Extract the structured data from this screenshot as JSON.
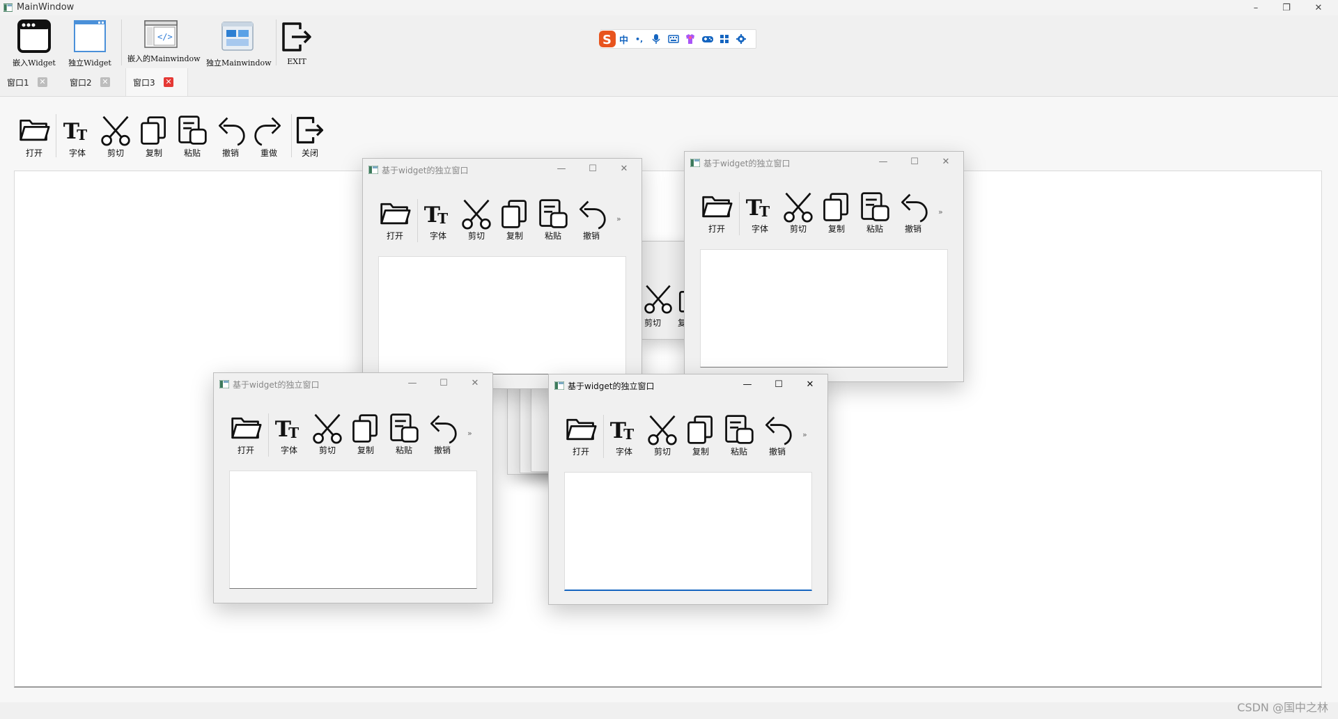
{
  "window": {
    "title": "MainWindow",
    "minimize": "–",
    "restore": "❐",
    "close": "✕"
  },
  "top_toolbar": [
    {
      "label": "嵌入Widget",
      "icon": "browser-window-icon"
    },
    {
      "label": "独立Widget",
      "icon": "blank-window-icon"
    },
    {
      "label": "嵌入的Mainwindow",
      "icon": "code-window-icon"
    },
    {
      "label": "独立Mainwindow",
      "icon": "dashboard-window-icon"
    },
    {
      "label": "EXIT",
      "icon": "exit-icon"
    }
  ],
  "ime_bar": {
    "logo": "S",
    "mode": "中",
    "punct": "•,",
    "icons": [
      "mic-icon",
      "keyboard-icon",
      "skin-icon",
      "gamepad-icon",
      "apps-icon",
      "settings-icon"
    ]
  },
  "tabs": [
    {
      "label": "窗口1",
      "active": false
    },
    {
      "label": "窗口2",
      "active": false
    },
    {
      "label": "窗口3",
      "active": true
    }
  ],
  "tab_close_glyph": "✕",
  "page_toolbar": [
    {
      "label": "打开",
      "icon": "folder-icon"
    },
    {
      "label": "字体",
      "icon": "font-icon"
    },
    {
      "label": "剪切",
      "icon": "scissors-icon"
    },
    {
      "label": "复制",
      "icon": "copy-icon"
    },
    {
      "label": "粘贴",
      "icon": "paste-icon"
    },
    {
      "label": "撤销",
      "icon": "undo-icon"
    },
    {
      "label": "重做",
      "icon": "redo-icon"
    },
    {
      "label": "关闭",
      "icon": "exit-icon"
    }
  ],
  "sub_window": {
    "title": "基于widget的独立窗口",
    "minimize": "—",
    "maximize": "☐",
    "close": "✕",
    "more": "»",
    "toolbar": [
      {
        "label": "打开"
      },
      {
        "label": "字体"
      },
      {
        "label": "剪切"
      },
      {
        "label": "复制"
      },
      {
        "label": "粘贴"
      },
      {
        "label": "撤销"
      }
    ]
  },
  "ghost_labels": {
    "cut": "剪切",
    "copy_partial": "复"
  },
  "watermark": "CSDN @国中之林",
  "colors": {
    "active_tab_close": "#e53935",
    "focus_border": "#1565c0",
    "ime_logo": "#e8541e"
  }
}
